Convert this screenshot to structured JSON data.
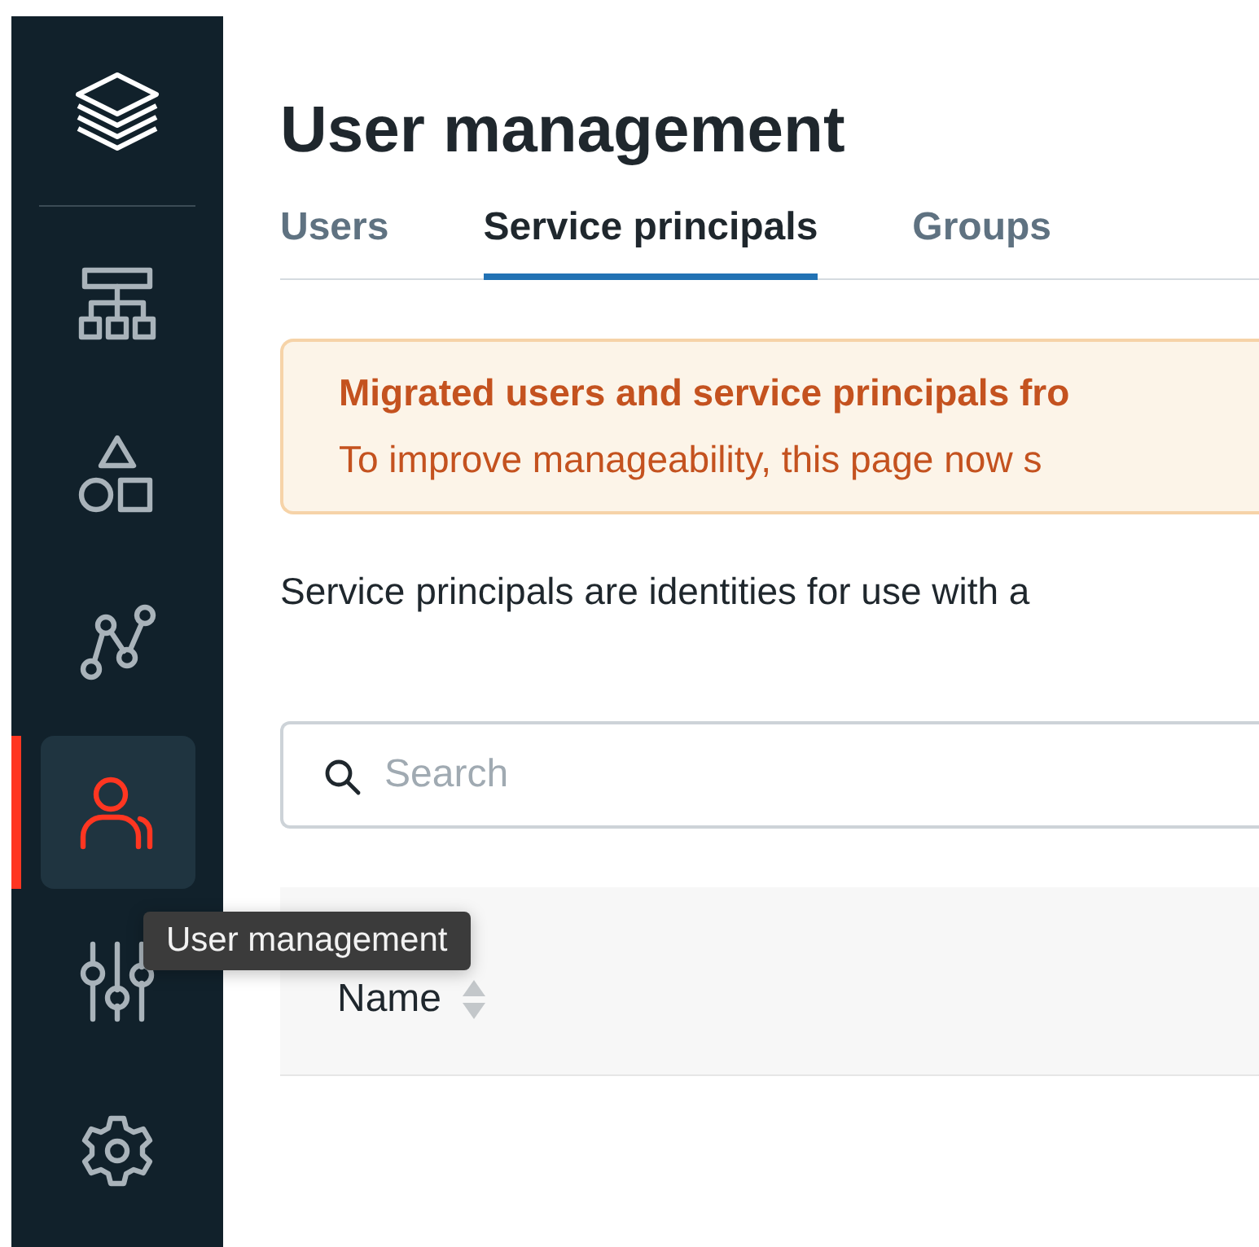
{
  "sidebar": {
    "items": [
      {
        "kind": "hierarchy",
        "selected": false
      },
      {
        "kind": "shapes",
        "selected": false
      },
      {
        "kind": "graph",
        "selected": false
      },
      {
        "kind": "user",
        "selected": true
      },
      {
        "kind": "sliders",
        "selected": false
      },
      {
        "kind": "gear",
        "selected": false
      }
    ]
  },
  "tooltip": {
    "text": "User management"
  },
  "page": {
    "title": "User management"
  },
  "tabs": [
    {
      "label": "Users",
      "selected": false
    },
    {
      "label": "Service principals",
      "selected": true
    },
    {
      "label": "Groups",
      "selected": false
    }
  ],
  "banner": {
    "title": "Migrated users and service principals fro",
    "text": "To improve manageability, this page now s"
  },
  "description": "Service principals are identities for use with a",
  "search": {
    "placeholder": "Search"
  },
  "table": {
    "columns": [
      {
        "label": "Name",
        "sortable": true
      }
    ]
  }
}
